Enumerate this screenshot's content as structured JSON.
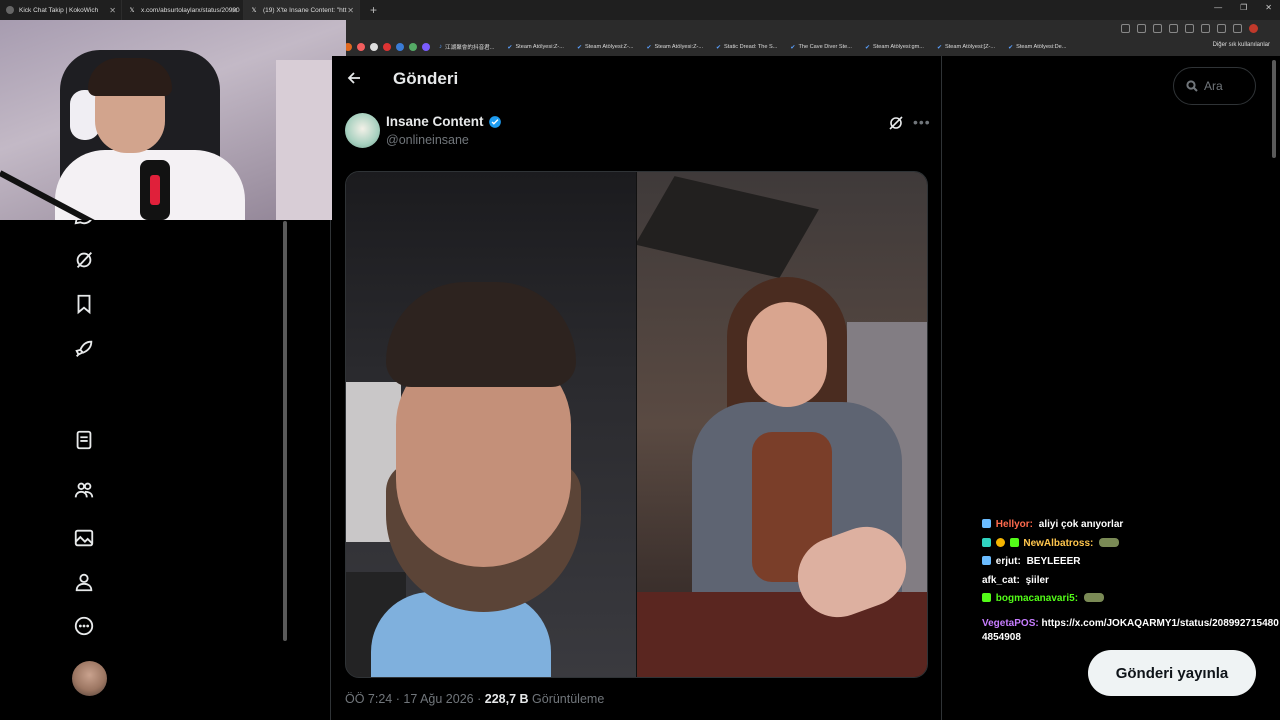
{
  "browser": {
    "tabs": [
      {
        "label": "Kick Chat Takip | KokoWich",
        "active": false
      },
      {
        "label": "x.com/absurtolaylarx/status/20900",
        "active": false
      },
      {
        "label": "(19) X'te Insane Content: \"htt",
        "active": true
      }
    ],
    "new_tab": "+",
    "bookmarks": [
      "江湖聚會的抖音君...",
      "Steam Atölyesi:Z-...",
      "Steam Atölyesi:Z-...",
      "Steam Atölyesi:Z-...",
      "Static Dread: The S...",
      "The Cave Diver Ste...",
      "Steam Atölyesi:gm...",
      "Steam Atölyesi:[Z-...",
      "Steam Atölyesi:De..."
    ],
    "other_bookmarks": "Diğer sık kullanılanlar"
  },
  "header": {
    "title": "Gönderi"
  },
  "tweet": {
    "author_name": "Insane Content",
    "author_handle": "@onlineinsane",
    "time": "ÖÖ 7:24",
    "separator": "·",
    "date": "17 Ağu 2026",
    "views_count": "228,7 B",
    "views_label": "Görüntüleme"
  },
  "search": {
    "placeholder": "Ara"
  },
  "chat": {
    "lines": [
      {
        "user": "Hellyor:",
        "user_color": "#ff6a4d",
        "message": "aliyi çok anıyorlar"
      },
      {
        "user": "NewAlbatross:",
        "user_color": "#ffc64d",
        "message": ""
      },
      {
        "user": "erjut:",
        "user_color": "#ffffff",
        "message": "BEYLEEER"
      },
      {
        "user": "afk_cat:",
        "user_color": "#ffffff",
        "message": "şiiler"
      },
      {
        "user": "bogmacanavari5:",
        "user_color": "#53fc18",
        "message": ""
      }
    ],
    "long_message": {
      "user": "VegetaPOS:",
      "user_color": "#c77dff",
      "line1": "https://x.com/JOKAQARMY1/status/208992715480",
      "line2": "4854908"
    }
  },
  "post_button_label": "Gönderi yayınla",
  "colors": {
    "background": "#000000",
    "text_primary": "#e7e9ea",
    "text_secondary": "#71767b",
    "verified_blue": "#1d9bf0",
    "border": "#2f3336"
  }
}
